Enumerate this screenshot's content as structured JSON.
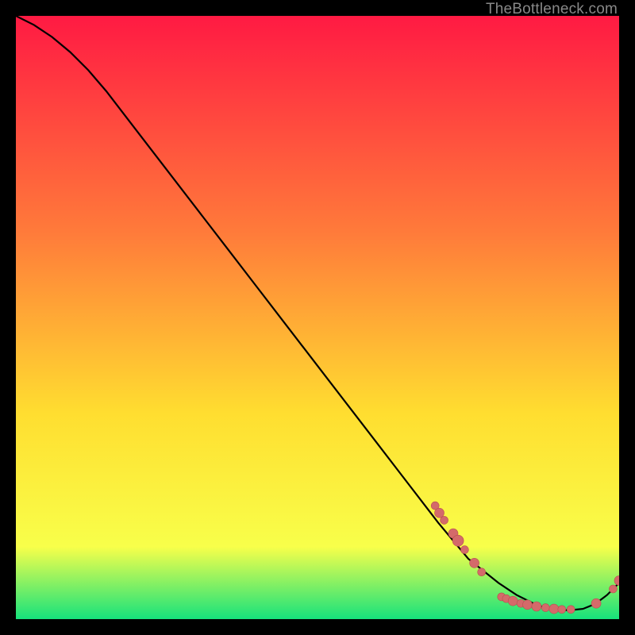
{
  "watermark": "TheBottleneck.com",
  "colors": {
    "gradient_top": "#ff1a43",
    "gradient_mid1": "#ff7b3a",
    "gradient_mid2": "#ffde30",
    "gradient_mid3": "#f8ff4a",
    "gradient_bottom": "#16e27c",
    "curve": "#000000",
    "dot_fill": "#d46a6a",
    "dot_stroke": "#b84f4f"
  },
  "chart_data": {
    "type": "line",
    "title": "",
    "xlabel": "",
    "ylabel": "",
    "xlim": [
      0,
      100
    ],
    "ylim": [
      0,
      100
    ],
    "curve": {
      "x": [
        0,
        3,
        6,
        9,
        12,
        15,
        20,
        25,
        30,
        35,
        40,
        45,
        50,
        55,
        60,
        65,
        70,
        75,
        80,
        83,
        86,
        88,
        90,
        92,
        94,
        96,
        98,
        100
      ],
      "y": [
        100,
        98.5,
        96.5,
        94,
        91,
        87.5,
        81,
        74.5,
        68,
        61.5,
        55,
        48.5,
        42,
        35.5,
        29,
        22.5,
        16,
        10,
        6,
        4,
        2.5,
        1.8,
        1.5,
        1.5,
        1.7,
        2.5,
        4,
        6
      ]
    },
    "scatter_clusters": [
      {
        "x": 69.5,
        "y": 18.8,
        "r": 5
      },
      {
        "x": 70.2,
        "y": 17.6,
        "r": 6
      },
      {
        "x": 71.0,
        "y": 16.4,
        "r": 5
      },
      {
        "x": 72.5,
        "y": 14.2,
        "r": 6
      },
      {
        "x": 73.3,
        "y": 13.0,
        "r": 7
      },
      {
        "x": 74.4,
        "y": 11.5,
        "r": 5
      },
      {
        "x": 76.0,
        "y": 9.3,
        "r": 6
      },
      {
        "x": 77.2,
        "y": 7.8,
        "r": 5
      },
      {
        "x": 80.5,
        "y": 3.7,
        "r": 5
      },
      {
        "x": 81.3,
        "y": 3.4,
        "r": 5
      },
      {
        "x": 82.4,
        "y": 3.0,
        "r": 6
      },
      {
        "x": 83.7,
        "y": 2.6,
        "r": 5
      },
      {
        "x": 84.8,
        "y": 2.4,
        "r": 6
      },
      {
        "x": 86.3,
        "y": 2.1,
        "r": 6
      },
      {
        "x": 87.8,
        "y": 1.9,
        "r": 5
      },
      {
        "x": 89.2,
        "y": 1.7,
        "r": 6
      },
      {
        "x": 90.5,
        "y": 1.6,
        "r": 5
      },
      {
        "x": 92.0,
        "y": 1.6,
        "r": 5
      },
      {
        "x": 96.2,
        "y": 2.6,
        "r": 6
      },
      {
        "x": 99.0,
        "y": 5.0,
        "r": 5
      },
      {
        "x": 100.0,
        "y": 6.4,
        "r": 6
      }
    ]
  }
}
